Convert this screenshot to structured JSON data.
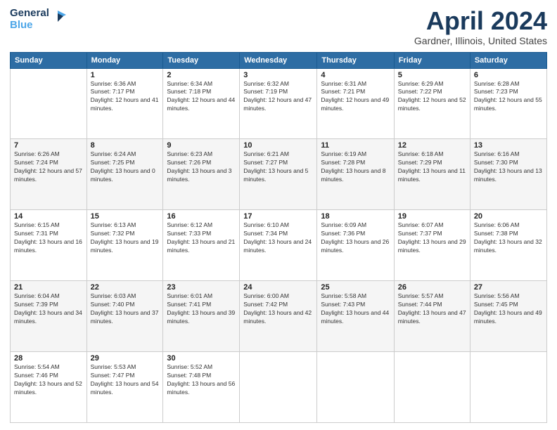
{
  "header": {
    "logo_line1": "General",
    "logo_line2": "Blue",
    "main_title": "April 2024",
    "subtitle": "Gardner, Illinois, United States"
  },
  "days_of_week": [
    "Sunday",
    "Monday",
    "Tuesday",
    "Wednesday",
    "Thursday",
    "Friday",
    "Saturday"
  ],
  "weeks": [
    [
      {
        "day": "",
        "sunrise": "",
        "sunset": "",
        "daylight": "",
        "empty": true
      },
      {
        "day": "1",
        "sunrise": "Sunrise: 6:36 AM",
        "sunset": "Sunset: 7:17 PM",
        "daylight": "Daylight: 12 hours and 41 minutes."
      },
      {
        "day": "2",
        "sunrise": "Sunrise: 6:34 AM",
        "sunset": "Sunset: 7:18 PM",
        "daylight": "Daylight: 12 hours and 44 minutes."
      },
      {
        "day": "3",
        "sunrise": "Sunrise: 6:32 AM",
        "sunset": "Sunset: 7:19 PM",
        "daylight": "Daylight: 12 hours and 47 minutes."
      },
      {
        "day": "4",
        "sunrise": "Sunrise: 6:31 AM",
        "sunset": "Sunset: 7:21 PM",
        "daylight": "Daylight: 12 hours and 49 minutes."
      },
      {
        "day": "5",
        "sunrise": "Sunrise: 6:29 AM",
        "sunset": "Sunset: 7:22 PM",
        "daylight": "Daylight: 12 hours and 52 minutes."
      },
      {
        "day": "6",
        "sunrise": "Sunrise: 6:28 AM",
        "sunset": "Sunset: 7:23 PM",
        "daylight": "Daylight: 12 hours and 55 minutes."
      }
    ],
    [
      {
        "day": "7",
        "sunrise": "Sunrise: 6:26 AM",
        "sunset": "Sunset: 7:24 PM",
        "daylight": "Daylight: 12 hours and 57 minutes."
      },
      {
        "day": "8",
        "sunrise": "Sunrise: 6:24 AM",
        "sunset": "Sunset: 7:25 PM",
        "daylight": "Daylight: 13 hours and 0 minutes."
      },
      {
        "day": "9",
        "sunrise": "Sunrise: 6:23 AM",
        "sunset": "Sunset: 7:26 PM",
        "daylight": "Daylight: 13 hours and 3 minutes."
      },
      {
        "day": "10",
        "sunrise": "Sunrise: 6:21 AM",
        "sunset": "Sunset: 7:27 PM",
        "daylight": "Daylight: 13 hours and 5 minutes."
      },
      {
        "day": "11",
        "sunrise": "Sunrise: 6:19 AM",
        "sunset": "Sunset: 7:28 PM",
        "daylight": "Daylight: 13 hours and 8 minutes."
      },
      {
        "day": "12",
        "sunrise": "Sunrise: 6:18 AM",
        "sunset": "Sunset: 7:29 PM",
        "daylight": "Daylight: 13 hours and 11 minutes."
      },
      {
        "day": "13",
        "sunrise": "Sunrise: 6:16 AM",
        "sunset": "Sunset: 7:30 PM",
        "daylight": "Daylight: 13 hours and 13 minutes."
      }
    ],
    [
      {
        "day": "14",
        "sunrise": "Sunrise: 6:15 AM",
        "sunset": "Sunset: 7:31 PM",
        "daylight": "Daylight: 13 hours and 16 minutes."
      },
      {
        "day": "15",
        "sunrise": "Sunrise: 6:13 AM",
        "sunset": "Sunset: 7:32 PM",
        "daylight": "Daylight: 13 hours and 19 minutes."
      },
      {
        "day": "16",
        "sunrise": "Sunrise: 6:12 AM",
        "sunset": "Sunset: 7:33 PM",
        "daylight": "Daylight: 13 hours and 21 minutes."
      },
      {
        "day": "17",
        "sunrise": "Sunrise: 6:10 AM",
        "sunset": "Sunset: 7:34 PM",
        "daylight": "Daylight: 13 hours and 24 minutes."
      },
      {
        "day": "18",
        "sunrise": "Sunrise: 6:09 AM",
        "sunset": "Sunset: 7:36 PM",
        "daylight": "Daylight: 13 hours and 26 minutes."
      },
      {
        "day": "19",
        "sunrise": "Sunrise: 6:07 AM",
        "sunset": "Sunset: 7:37 PM",
        "daylight": "Daylight: 13 hours and 29 minutes."
      },
      {
        "day": "20",
        "sunrise": "Sunrise: 6:06 AM",
        "sunset": "Sunset: 7:38 PM",
        "daylight": "Daylight: 13 hours and 32 minutes."
      }
    ],
    [
      {
        "day": "21",
        "sunrise": "Sunrise: 6:04 AM",
        "sunset": "Sunset: 7:39 PM",
        "daylight": "Daylight: 13 hours and 34 minutes."
      },
      {
        "day": "22",
        "sunrise": "Sunrise: 6:03 AM",
        "sunset": "Sunset: 7:40 PM",
        "daylight": "Daylight: 13 hours and 37 minutes."
      },
      {
        "day": "23",
        "sunrise": "Sunrise: 6:01 AM",
        "sunset": "Sunset: 7:41 PM",
        "daylight": "Daylight: 13 hours and 39 minutes."
      },
      {
        "day": "24",
        "sunrise": "Sunrise: 6:00 AM",
        "sunset": "Sunset: 7:42 PM",
        "daylight": "Daylight: 13 hours and 42 minutes."
      },
      {
        "day": "25",
        "sunrise": "Sunrise: 5:58 AM",
        "sunset": "Sunset: 7:43 PM",
        "daylight": "Daylight: 13 hours and 44 minutes."
      },
      {
        "day": "26",
        "sunrise": "Sunrise: 5:57 AM",
        "sunset": "Sunset: 7:44 PM",
        "daylight": "Daylight: 13 hours and 47 minutes."
      },
      {
        "day": "27",
        "sunrise": "Sunrise: 5:56 AM",
        "sunset": "Sunset: 7:45 PM",
        "daylight": "Daylight: 13 hours and 49 minutes."
      }
    ],
    [
      {
        "day": "28",
        "sunrise": "Sunrise: 5:54 AM",
        "sunset": "Sunset: 7:46 PM",
        "daylight": "Daylight: 13 hours and 52 minutes."
      },
      {
        "day": "29",
        "sunrise": "Sunrise: 5:53 AM",
        "sunset": "Sunset: 7:47 PM",
        "daylight": "Daylight: 13 hours and 54 minutes."
      },
      {
        "day": "30",
        "sunrise": "Sunrise: 5:52 AM",
        "sunset": "Sunset: 7:48 PM",
        "daylight": "Daylight: 13 hours and 56 minutes."
      },
      {
        "day": "",
        "sunrise": "",
        "sunset": "",
        "daylight": "",
        "empty": true
      },
      {
        "day": "",
        "sunrise": "",
        "sunset": "",
        "daylight": "",
        "empty": true
      },
      {
        "day": "",
        "sunrise": "",
        "sunset": "",
        "daylight": "",
        "empty": true
      },
      {
        "day": "",
        "sunrise": "",
        "sunset": "",
        "daylight": "",
        "empty": true
      }
    ]
  ]
}
